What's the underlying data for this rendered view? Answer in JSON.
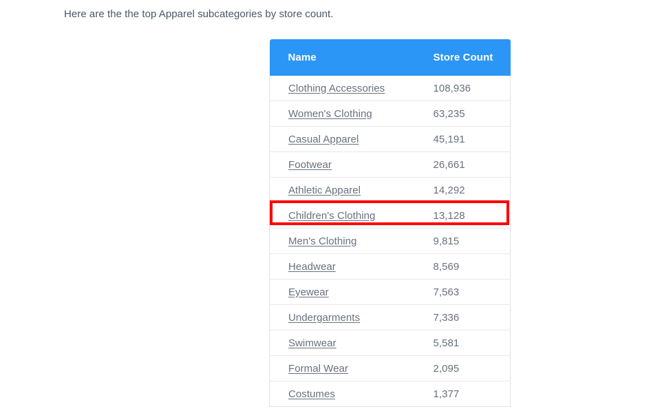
{
  "intro": {
    "text": "Here are the the top Apparel subcategories by store count."
  },
  "table": {
    "columns": [
      "Name",
      "Store Count"
    ],
    "header_bg": "#2b96f5",
    "header_text_color": "#ffffff",
    "link_color": "#68707d",
    "rows": [
      {
        "name": "Clothing Accessories",
        "store_count": "108,936"
      },
      {
        "name": "Women's Clothing",
        "store_count": "63,235"
      },
      {
        "name": "Casual Apparel",
        "store_count": "45,191"
      },
      {
        "name": "Footwear",
        "store_count": "26,661"
      },
      {
        "name": "Athletic Apparel",
        "store_count": "14,292"
      },
      {
        "name": "Children's Clothing",
        "store_count": "13,128"
      },
      {
        "name": "Men's Clothing",
        "store_count": "9,815"
      },
      {
        "name": "Headwear",
        "store_count": "8,569"
      },
      {
        "name": "Eyewear",
        "store_count": "7,563"
      },
      {
        "name": "Undergarments",
        "store_count": "7,336"
      },
      {
        "name": "Swimwear",
        "store_count": "5,581"
      },
      {
        "name": "Formal Wear",
        "store_count": "2,095"
      },
      {
        "name": "Costumes",
        "store_count": "1,377"
      }
    ]
  },
  "highlight": {
    "target_row_name": "Children's Clothing",
    "color": "#ff0000"
  }
}
